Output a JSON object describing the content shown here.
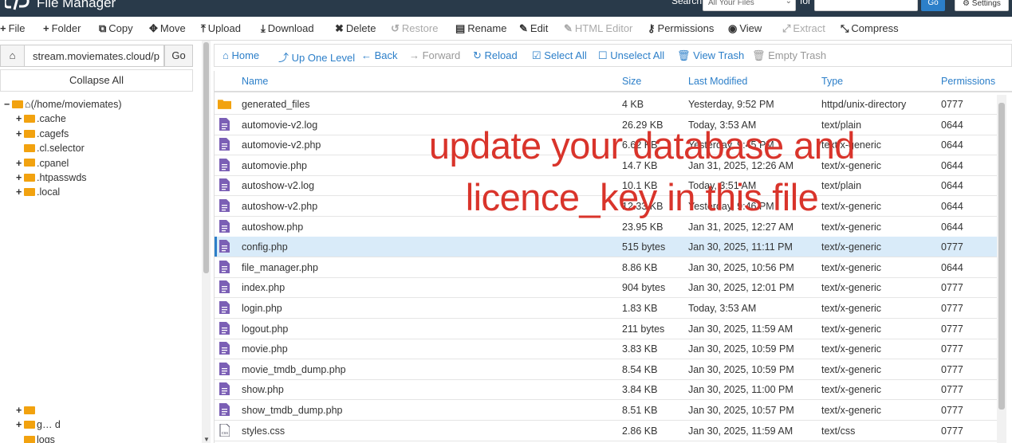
{
  "header": {
    "title": "File Manager",
    "search_label": "Search",
    "search_scope": "All Your Files",
    "for_label": "for",
    "search_value": "",
    "go_label": "Go",
    "settings_label": "Settings"
  },
  "toolbar": {
    "items": [
      {
        "label": "File",
        "icon": "plus-icon",
        "glyph": "+",
        "enabled": true
      },
      {
        "label": "Folder",
        "icon": "plus-icon",
        "glyph": "+",
        "enabled": true
      },
      {
        "label": "Copy",
        "icon": "copy-icon",
        "glyph": "⧉",
        "enabled": true
      },
      {
        "label": "Move",
        "icon": "move-icon",
        "glyph": "✥",
        "enabled": true
      },
      {
        "label": "Upload",
        "icon": "upload-icon",
        "glyph": "⤒",
        "enabled": true
      },
      {
        "label": "Download",
        "icon": "download-icon",
        "glyph": "⤓",
        "enabled": true
      },
      {
        "label": "Delete",
        "icon": "delete-icon",
        "glyph": "✖",
        "enabled": true
      },
      {
        "label": "Restore",
        "icon": "restore-icon",
        "glyph": "↺",
        "enabled": false
      },
      {
        "label": "Rename",
        "icon": "rename-icon",
        "glyph": "▤",
        "enabled": true
      },
      {
        "label": "Edit",
        "icon": "pencil-icon",
        "glyph": "✎",
        "enabled": true
      },
      {
        "label": "HTML Editor",
        "icon": "html-editor-icon",
        "glyph": "✎",
        "enabled": false
      },
      {
        "label": "Permissions",
        "icon": "key-icon",
        "glyph": "⚷",
        "enabled": true
      },
      {
        "label": "View",
        "icon": "eye-icon",
        "glyph": "◉",
        "enabled": true
      },
      {
        "label": "Extract",
        "icon": "extract-icon",
        "glyph": "⤢",
        "enabled": false
      },
      {
        "label": "Compress",
        "icon": "compress-icon",
        "glyph": "⤡",
        "enabled": true
      }
    ]
  },
  "left_panel": {
    "path_value": "stream.moviemates.cloud/p",
    "go_label": "Go",
    "collapse_label": "Collapse All",
    "tree": [
      {
        "label": "(/home/moviemates)",
        "toggle": "−",
        "icon": "home"
      },
      {
        "label": ".cache",
        "toggle": "+",
        "icon": "folder"
      },
      {
        "label": ".cagefs",
        "toggle": "+",
        "icon": "folder"
      },
      {
        "label": ".cl.selector",
        "toggle": "",
        "icon": "folder"
      },
      {
        "label": ".cpanel",
        "toggle": "+",
        "icon": "folder"
      },
      {
        "label": ".htpasswds",
        "toggle": "+",
        "icon": "folder"
      },
      {
        "label": ".local",
        "toggle": "+",
        "icon": "folder"
      }
    ],
    "tree_bottom": [
      {
        "label": "",
        "toggle": "+",
        "icon": "folder"
      },
      {
        "label": "g… d",
        "toggle": "+",
        "icon": "folder"
      },
      {
        "label": "logs",
        "toggle": "",
        "icon": "folder"
      }
    ]
  },
  "nav": {
    "items": [
      {
        "label": "Home",
        "icon": "home-icon",
        "glyph": "⌂",
        "enabled": true
      },
      {
        "label": "Up One Level",
        "icon": "level-up-icon",
        "glyph": "⤴",
        "enabled": true
      },
      {
        "label": "Back",
        "icon": "back-arrow-icon",
        "glyph": "←",
        "enabled": true
      },
      {
        "label": "Forward",
        "icon": "forward-arrow-icon",
        "glyph": "→",
        "enabled": false
      },
      {
        "label": "Reload",
        "icon": "reload-icon",
        "glyph": "↻",
        "enabled": true
      },
      {
        "label": "Select All",
        "icon": "check-square-icon",
        "glyph": "☑",
        "enabled": true
      },
      {
        "label": "Unselect All",
        "icon": "square-icon",
        "glyph": "☐",
        "enabled": true
      },
      {
        "label": "View Trash",
        "icon": "trash-icon",
        "glyph": "🗑",
        "enabled": true
      },
      {
        "label": "Empty Trash",
        "icon": "trash-icon",
        "glyph": "🗑",
        "enabled": false
      }
    ]
  },
  "table": {
    "columns": [
      "Name",
      "Size",
      "Last Modified",
      "Type",
      "Permissions"
    ],
    "rows": [
      {
        "name": "generated_files",
        "size": "4 KB",
        "modified": "Yesterday, 9:52 PM",
        "type": "httpd/unix-directory",
        "perms": "0777",
        "kind": "folder"
      },
      {
        "name": "automovie-v2.log",
        "size": "26.29 KB",
        "modified": "Today, 3:53 AM",
        "type": "text/plain",
        "perms": "0644",
        "kind": "file"
      },
      {
        "name": "automovie-v2.php",
        "size": "6.62 KB",
        "modified": "Yesterday, 9:45 PM",
        "type": "text/x-generic",
        "perms": "0644",
        "kind": "file"
      },
      {
        "name": "automovie.php",
        "size": "14.7 KB",
        "modified": "Jan 31, 2025, 12:26 AM",
        "type": "text/x-generic",
        "perms": "0644",
        "kind": "file"
      },
      {
        "name": "autoshow-v2.log",
        "size": "10.1 KB",
        "modified": "Today, 3:51 AM",
        "type": "text/plain",
        "perms": "0644",
        "kind": "file"
      },
      {
        "name": "autoshow-v2.php",
        "size": "12.33 KB",
        "modified": "Yesterday, 9:46 PM",
        "type": "text/x-generic",
        "perms": "0644",
        "kind": "file"
      },
      {
        "name": "autoshow.php",
        "size": "23.95 KB",
        "modified": "Jan 31, 2025, 12:27 AM",
        "type": "text/x-generic",
        "perms": "0644",
        "kind": "file"
      },
      {
        "name": "config.php",
        "size": "515 bytes",
        "modified": "Jan 30, 2025, 11:11 PM",
        "type": "text/x-generic",
        "perms": "0777",
        "kind": "file",
        "selected": true
      },
      {
        "name": "file_manager.php",
        "size": "8.86 KB",
        "modified": "Jan 30, 2025, 10:56 PM",
        "type": "text/x-generic",
        "perms": "0644",
        "kind": "file"
      },
      {
        "name": "index.php",
        "size": "904 bytes",
        "modified": "Jan 30, 2025, 12:01 PM",
        "type": "text/x-generic",
        "perms": "0777",
        "kind": "file"
      },
      {
        "name": "login.php",
        "size": "1.83 KB",
        "modified": "Today, 3:53 AM",
        "type": "text/x-generic",
        "perms": "0777",
        "kind": "file"
      },
      {
        "name": "logout.php",
        "size": "211 bytes",
        "modified": "Jan 30, 2025, 11:59 AM",
        "type": "text/x-generic",
        "perms": "0777",
        "kind": "file"
      },
      {
        "name": "movie.php",
        "size": "3.83 KB",
        "modified": "Jan 30, 2025, 10:59 PM",
        "type": "text/x-generic",
        "perms": "0777",
        "kind": "file"
      },
      {
        "name": "movie_tmdb_dump.php",
        "size": "8.54 KB",
        "modified": "Jan 30, 2025, 10:59 PM",
        "type": "text/x-generic",
        "perms": "0777",
        "kind": "file"
      },
      {
        "name": "show.php",
        "size": "3.84 KB",
        "modified": "Jan 30, 2025, 11:00 PM",
        "type": "text/x-generic",
        "perms": "0777",
        "kind": "file"
      },
      {
        "name": "show_tmdb_dump.php",
        "size": "8.51 KB",
        "modified": "Jan 30, 2025, 10:57 PM",
        "type": "text/x-generic",
        "perms": "0777",
        "kind": "file"
      },
      {
        "name": "styles.css",
        "size": "2.86 KB",
        "modified": "Jan 30, 2025, 11:59 AM",
        "type": "text/css",
        "perms": "0777",
        "kind": "css"
      }
    ]
  },
  "overlay": {
    "text": "update your database and licence_key in this file"
  },
  "colors": {
    "header_bg": "#293a4a",
    "link_blue": "#2c7fc9",
    "folder": "#f2a20f",
    "file_icon": "#7b5fb5",
    "selected_row": "#d9ebf9",
    "annotation": "#d9342b"
  }
}
